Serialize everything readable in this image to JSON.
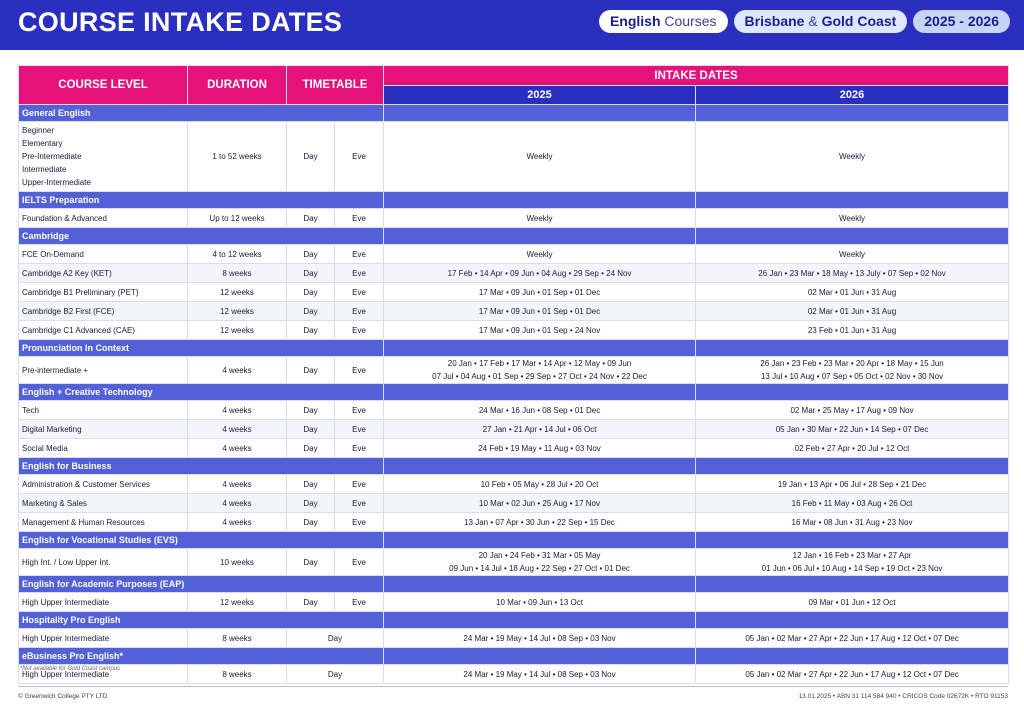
{
  "header": {
    "title": "COURSE INTAKE DATES",
    "pill1_bold": "English",
    "pill1_light": "Courses",
    "pill2_bold": "Brisbane",
    "pill2_amp": "&",
    "pill2_bold2": "Gold Coast",
    "pill3": "2025 - 2026"
  },
  "table": {
    "col_course_level": "COURSE LEVEL",
    "col_duration": "DURATION",
    "col_timetable": "TIMETABLE",
    "col_intake": "INTAKE DATES",
    "year1": "2025",
    "year2": "2026"
  },
  "sections": [
    {
      "title": "General English",
      "rows": [
        {
          "levels": [
            "Beginner",
            "Elementary",
            "Pre-Intermediate",
            "Intermediate",
            "Upper-Intermediate"
          ],
          "duration": "1 to 52 weeks",
          "day": "Day",
          "eve": "Eve",
          "d2025": "Weekly",
          "d2026": "Weekly"
        }
      ]
    },
    {
      "title": "IELTS Preparation",
      "rows": [
        {
          "levels": [
            "Foundation & Advanced"
          ],
          "duration": "Up to 12 weeks",
          "day": "Day",
          "eve": "Eve",
          "d2025": "Weekly",
          "d2026": "Weekly"
        }
      ]
    },
    {
      "title": "Cambridge",
      "rows": [
        {
          "levels": [
            "FCE On-Demand"
          ],
          "duration": "4 to 12 weeks",
          "day": "Day",
          "eve": "Eve",
          "d2025": "Weekly",
          "d2026": "Weekly"
        },
        {
          "levels": [
            "Cambridge A2 Key (KET)"
          ],
          "duration": "8 weeks",
          "day": "Day",
          "eve": "Eve",
          "d2025": "17 Feb • 14 Apr • 09 Jun • 04 Aug • 29 Sep • 24 Nov",
          "d2026": "26 Jan • 23 Mar • 18 May • 13 July • 07 Sep • 02 Nov"
        },
        {
          "levels": [
            "Cambridge B1 Preliminary (PET)"
          ],
          "duration": "12 weeks",
          "day": "Day",
          "eve": "Eve",
          "d2025": "17 Mar • 09 Jun • 01 Sep • 01 Dec",
          "d2026": "02 Mar • 01 Jun • 31 Aug"
        },
        {
          "levels": [
            "Cambridge B2 First (FCE)"
          ],
          "duration": "12 weeks",
          "day": "Day",
          "eve": "Eve",
          "d2025": "17 Mar • 09 Jun • 01 Sep • 01 Dec",
          "d2026": "02 Mar • 01 Jun • 31 Aug"
        },
        {
          "levels": [
            "Cambridge C1 Advanced (CAE)"
          ],
          "duration": "12 weeks",
          "day": "Day",
          "eve": "Eve",
          "d2025": "17 Mar • 09 Jun • 01 Sep • 24 Nov",
          "d2026": "23 Feb • 01 Jun • 31 Aug"
        }
      ]
    },
    {
      "title": "Pronunciation In Context",
      "rows": [
        {
          "levels": [
            "Pre-intermediate +"
          ],
          "duration": "4 weeks",
          "day": "Day",
          "eve": "Eve",
          "d2025": "20 Jan • 17 Feb • 17 Mar • 14 Apr • 12 May • 09 Jun\n07 Jul • 04 Aug • 01 Sep • 29 Sep • 27 Oct • 24 Nov • 22 Dec",
          "d2026": "26 Jan • 23 Feb • 23 Mar • 20 Apr • 18 May • 15 Jun\n13 Jul • 10 Aug • 07 Sep • 05 Oct • 02 Nov • 30 Nov"
        }
      ]
    },
    {
      "title": "English + Creative Technology",
      "rows": [
        {
          "levels": [
            "Tech"
          ],
          "duration": "4 weeks",
          "day": "Day",
          "eve": "Eve",
          "d2025": "24 Mar • 16 Jun • 08 Sep • 01 Dec",
          "d2026": "02 Mar • 25 May • 17 Aug • 09 Nov"
        },
        {
          "levels": [
            "Digital Marketing"
          ],
          "duration": "4 weeks",
          "day": "Day",
          "eve": "Eve",
          "d2025": "27 Jan • 21 Apr • 14 Jul • 06 Oct",
          "d2026": "05 Jan • 30 Mar • 22 Jun • 14 Sep • 07 Dec"
        },
        {
          "levels": [
            "Social Media"
          ],
          "duration": "4 weeks",
          "day": "Day",
          "eve": "Eve",
          "d2025": "24 Feb • 19 May • 11 Aug • 03 Nov",
          "d2026": "02 Feb • 27 Apr • 20 Jul • 12 Oct"
        }
      ]
    },
    {
      "title": "English for Business",
      "rows": [
        {
          "levels": [
            "Administration & Customer Services"
          ],
          "duration": "4 weeks",
          "day": "Day",
          "eve": "Eve",
          "d2025": "10 Feb • 05 May • 28 Jul • 20 Oct",
          "d2026": "19 Jan • 13 Apr • 06 Jul • 28 Sep • 21 Dec"
        },
        {
          "levels": [
            "Marketing & Sales"
          ],
          "duration": "4 weeks",
          "day": "Day",
          "eve": "Eve",
          "d2025": "10 Mar • 02 Jun • 25 Aug • 17 Nov",
          "d2026": "16 Feb • 11 May • 03 Aug • 26 Oct"
        },
        {
          "levels": [
            "Management & Human Resources"
          ],
          "duration": "4 weeks",
          "day": "Day",
          "eve": "Eve",
          "d2025": "13 Jan • 07 Apr • 30 Jun • 22 Sep • 15 Dec",
          "d2026": "16 Mar • 08 Jun • 31 Aug • 23 Nov"
        }
      ]
    },
    {
      "title": "English for Vocational Studies (EVS)",
      "rows": [
        {
          "levels": [
            "High Int. / Low Upper Int."
          ],
          "duration": "10 weeks",
          "day": "Day",
          "eve": "Eve",
          "d2025": "20 Jan • 24 Feb • 31 Mar • 05 May\n09 Jun • 14 Jul • 18 Aug • 22 Sep • 27 Oct • 01 Dec",
          "d2026": "12 Jan • 16 Feb • 23 Mar • 27 Apr\n01 Jun • 06 Jul • 10 Aug • 14 Sep • 19 Oct • 23 Nov"
        }
      ]
    },
    {
      "title": "English for Academic Purposes (EAP)",
      "rows": [
        {
          "levels": [
            "High Upper Intermediate"
          ],
          "duration": "12 weeks",
          "day": "Day",
          "eve": "Eve",
          "d2025": "10 Mar • 09 Jun • 13 Oct",
          "d2026": "09 Mar • 01 Jun • 12 Oct"
        }
      ]
    },
    {
      "title": "Hospitality Pro English",
      "rows": [
        {
          "levels": [
            "High Upper Intermediate"
          ],
          "duration": "8 weeks",
          "day": "Day",
          "eve": "",
          "d2025": "24 Mar • 19 May • 14 Jul • 08 Sep • 03 Nov",
          "d2026": "05 Jan • 02 Mar • 27 Apr • 22 Jun • 17 Aug • 12 Oct • 07 Dec"
        }
      ]
    },
    {
      "title": "eBusiness Pro English*",
      "rows": [
        {
          "levels": [
            "High Upper Intermediate"
          ],
          "duration": "8 weeks",
          "day": "Day",
          "eve": "",
          "d2025": "24 Mar • 19 May • 14 Jul • 08 Sep • 03 Nov",
          "d2026": "05 Jan • 02 Mar • 27 Apr • 22 Jun • 17 Aug • 12 Oct • 07 Dec"
        }
      ]
    }
  ],
  "footer": {
    "note": "*Not available for Gold Coast campus",
    "left": "© Greenwich College PTY LTD",
    "right": "13.01.2025 • ABN 31 114 584 940 • CRICOS Code 02672K • RTO 91153"
  }
}
